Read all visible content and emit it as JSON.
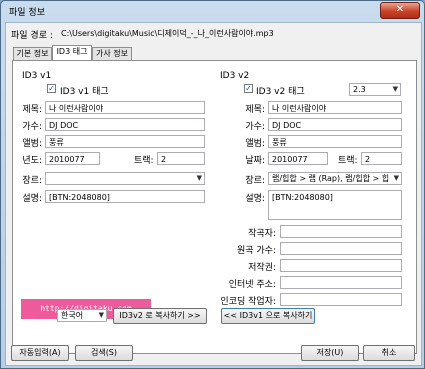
{
  "window": {
    "title": "파일 정보",
    "close_glyph": "✕"
  },
  "file_path": {
    "label": "파일 경로 :",
    "value": "C:\\Users\\digitaku\\Music\\디제이덕_-_나_이런사람이야.mp3"
  },
  "tabs": [
    "기본 정보",
    "ID3 태그",
    "가사 정보"
  ],
  "v1": {
    "section": "ID3 v1",
    "tag_checkbox": "ID3 v1 태그",
    "title_label": "제목:",
    "title_value": "나 이런사람이야",
    "artist_label": "가수:",
    "artist_value": "DJ DOC",
    "album_label": "앨범:",
    "album_value": "풍류",
    "year_label": "년도:",
    "year_value": "2010077",
    "track_label": "트랙:",
    "track_value": "2",
    "genre_label": "장르:",
    "genre_value": "",
    "comment_label": "설명:",
    "comment_value": "[BTN:2048080]",
    "watermark": "http://digitaku.com",
    "lang_value": "한국어",
    "copy_button": "ID3v2 로 복사하기 >>"
  },
  "v2": {
    "section": "ID3 v2",
    "tag_checkbox": "ID3 v2 태그",
    "version_value": "2.3",
    "title_label": "제목:",
    "title_value": "나 이런사람이야",
    "artist_label": "가수:",
    "artist_value": "DJ DOC",
    "album_label": "앨범:",
    "album_value": "풍류",
    "date_label": "날짜:",
    "date_value": "2010077",
    "track_label": "트랙:",
    "track_value": "2",
    "genre_label": "장르:",
    "genre_value": "랩/힙합 > 랩 (Rap), 랩/힙합 > 힙",
    "comment_label": "설명:",
    "comment_value": "[BTN:2048080]",
    "composer_label": "작곡자:",
    "composer_value": "",
    "original_artist_label": "원곡 가수:",
    "original_artist_value": "",
    "copyright_label": "저작권:",
    "copyright_value": "",
    "url_label": "인터넷 주소:",
    "url_value": "",
    "encoded_by_label": "인코딩 작업자:",
    "encoded_by_value": "",
    "copy_button": "<< ID3v1 으로 복사하기"
  },
  "footer": {
    "auto_input": "자동입력(A)",
    "search": "검색(S)",
    "save": "저장(U)",
    "cancel": "취소"
  },
  "colors": {
    "watermark_bg": "#ee5b9a",
    "close_button": "#c7432a"
  }
}
